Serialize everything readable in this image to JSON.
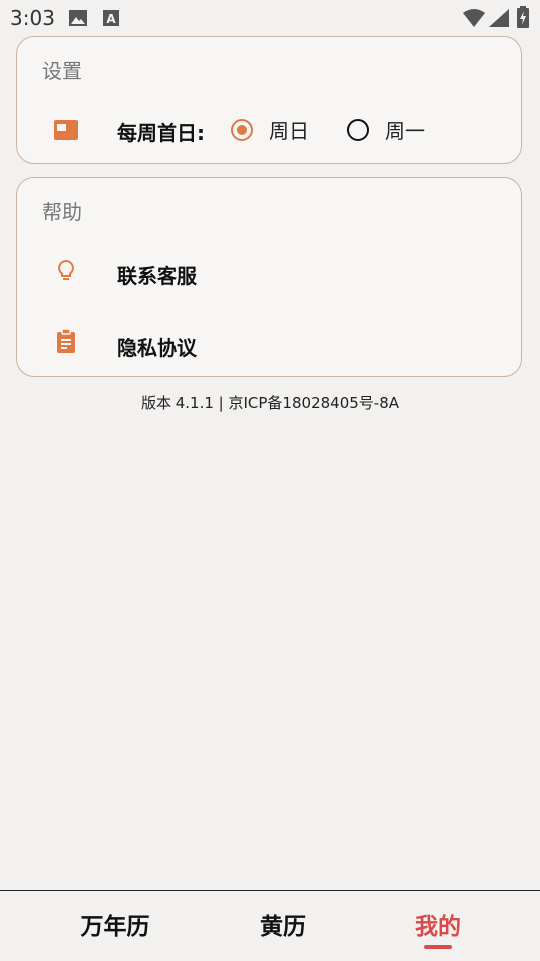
{
  "status_bar": {
    "time": "3:03",
    "icons": [
      "image-icon",
      "a-text-icon",
      "wifi-icon",
      "signal-icon",
      "battery-icon"
    ]
  },
  "settings_card": {
    "title": "设置",
    "week_start": {
      "icon": "calendar-icon",
      "label": "每周首日:",
      "options": [
        {
          "label": "周日",
          "selected": true
        },
        {
          "label": "周一",
          "selected": false
        }
      ]
    }
  },
  "help_card": {
    "title": "帮助",
    "items": [
      {
        "icon": "lightbulb-icon",
        "label": "联系客服"
      },
      {
        "icon": "clipboard-icon",
        "label": "隐私协议"
      }
    ]
  },
  "footer": {
    "version_text": "版本 4.1.1 | 京ICP备18028405号-8A"
  },
  "tabbar": {
    "tabs": [
      {
        "label": "万年历",
        "active": false
      },
      {
        "label": "黄历",
        "active": false
      },
      {
        "label": "我的",
        "active": true
      }
    ]
  },
  "colors": {
    "accent": "#e07a42",
    "active_tab": "#d94b4b",
    "background": "#f3f1ef",
    "card_border": "#c8b6a0"
  }
}
